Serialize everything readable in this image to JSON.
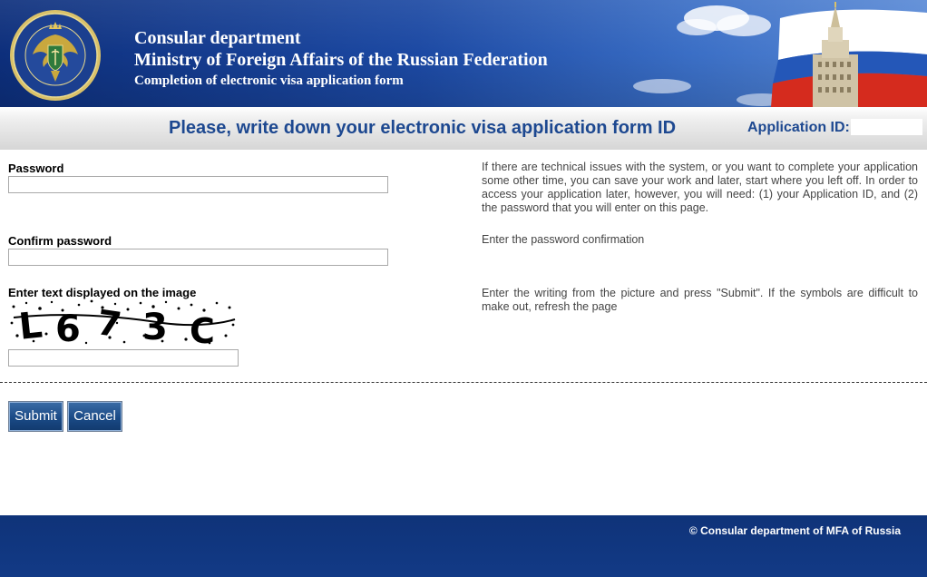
{
  "header": {
    "line1": "Consular department",
    "line2": "Ministry of Foreign Affairs of the Russian Federation",
    "line3": "Completion of electronic visa application form",
    "emblem_icon": "mfa-consular-emblem-icon",
    "flag_colors": [
      "#ffffff",
      "#1d4fb0",
      "#d52b1e"
    ]
  },
  "titlebar": {
    "title": "Please, write down your electronic visa application form ID",
    "app_id_label": "Application ID:",
    "app_id_value": ""
  },
  "form": {
    "password_label": "Password",
    "password_value": "",
    "confirm_label": "Confirm password",
    "confirm_value": "",
    "captcha_label": "Enter text displayed on the image",
    "captcha_image_text": "L673C",
    "captcha_value": ""
  },
  "help": {
    "password": "If there are technical issues with the system, or you want to complete your application some other time, you can save your work and later, start where you left off. In order to access your application later, however, you will need: (1) your Application ID, and (2) the password that you will enter on this page.",
    "confirm": "Enter the password confirmation",
    "captcha": "Enter the writing from the picture and press \"Submit\". If the symbols are difficult to make out, refresh the page"
  },
  "buttons": {
    "submit": "Submit",
    "cancel": "Cancel"
  },
  "footer": {
    "copyright": "© Consular department of MFA of Russia"
  },
  "colors": {
    "header_blue": "#1c49a3",
    "title_blue": "#1d4890",
    "footer_blue": "#0f3379",
    "button_blue": "#1a4a86"
  }
}
